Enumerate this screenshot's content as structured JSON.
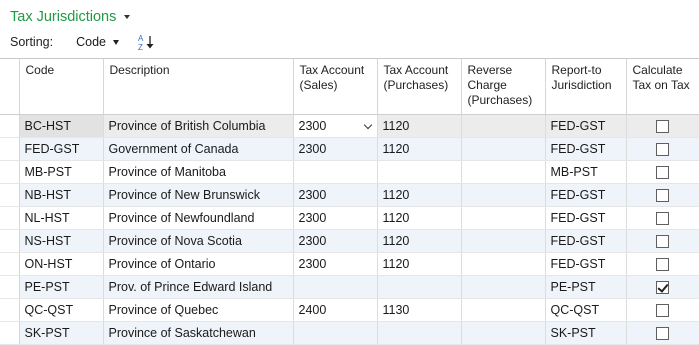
{
  "page": {
    "title": "Tax Jurisdictions"
  },
  "sorting": {
    "label": "Sorting:",
    "value": "Code",
    "direction_icon": "sort-ascending-az-icon"
  },
  "columns": {
    "code": "Code",
    "description": "Description",
    "tax_account_sales": "Tax Account (Sales)",
    "tax_account_purchases": "Tax Account (Purchases)",
    "reverse_charge_purchases": "Reverse Charge (Purchases)",
    "report_to_jurisdiction": "Report-to Jurisdiction",
    "calculate_tax_on_tax": "Calculate Tax on Tax"
  },
  "rows": [
    {
      "code": "BC-HST",
      "description": "Province of British Columbia",
      "tax_account_sales": "2300",
      "tax_account_purchases": "1120",
      "reverse_charge_purchases": "",
      "report_to_jurisdiction": "FED-GST",
      "calculate_tax_on_tax": false
    },
    {
      "code": "FED-GST",
      "description": "Government of Canada",
      "tax_account_sales": "2300",
      "tax_account_purchases": "1120",
      "reverse_charge_purchases": "",
      "report_to_jurisdiction": "FED-GST",
      "calculate_tax_on_tax": false
    },
    {
      "code": "MB-PST",
      "description": "Province of Manitoba",
      "tax_account_sales": "",
      "tax_account_purchases": "",
      "reverse_charge_purchases": "",
      "report_to_jurisdiction": "MB-PST",
      "calculate_tax_on_tax": false
    },
    {
      "code": "NB-HST",
      "description": "Province of New Brunswick",
      "tax_account_sales": "2300",
      "tax_account_purchases": "1120",
      "reverse_charge_purchases": "",
      "report_to_jurisdiction": "FED-GST",
      "calculate_tax_on_tax": false
    },
    {
      "code": "NL-HST",
      "description": "Province of Newfoundland",
      "tax_account_sales": "2300",
      "tax_account_purchases": "1120",
      "reverse_charge_purchases": "",
      "report_to_jurisdiction": "FED-GST",
      "calculate_tax_on_tax": false
    },
    {
      "code": "NS-HST",
      "description": "Province of Nova Scotia",
      "tax_account_sales": "2300",
      "tax_account_purchases": "1120",
      "reverse_charge_purchases": "",
      "report_to_jurisdiction": "FED-GST",
      "calculate_tax_on_tax": false
    },
    {
      "code": "ON-HST",
      "description": "Province of Ontario",
      "tax_account_sales": "2300",
      "tax_account_purchases": "1120",
      "reverse_charge_purchases": "",
      "report_to_jurisdiction": "FED-GST",
      "calculate_tax_on_tax": false
    },
    {
      "code": "PE-PST",
      "description": "Prov. of Prince Edward Island",
      "tax_account_sales": "",
      "tax_account_purchases": "",
      "reverse_charge_purchases": "",
      "report_to_jurisdiction": "PE-PST",
      "calculate_tax_on_tax": true
    },
    {
      "code": "QC-QST",
      "description": "Province of Quebec",
      "tax_account_sales": "2400",
      "tax_account_purchases": "1130",
      "reverse_charge_purchases": "",
      "report_to_jurisdiction": "QC-QST",
      "calculate_tax_on_tax": false
    },
    {
      "code": "SK-PST",
      "description": "Province of Saskatchewan",
      "tax_account_sales": "",
      "tax_account_purchases": "",
      "reverse_charge_purchases": "",
      "report_to_jurisdiction": "SK-PST",
      "calculate_tax_on_tax": false
    }
  ],
  "selected_row_index": 0,
  "colors": {
    "title": "#1f9a45",
    "row_alt": "#eff4fb",
    "row_selected": "#ececec"
  }
}
